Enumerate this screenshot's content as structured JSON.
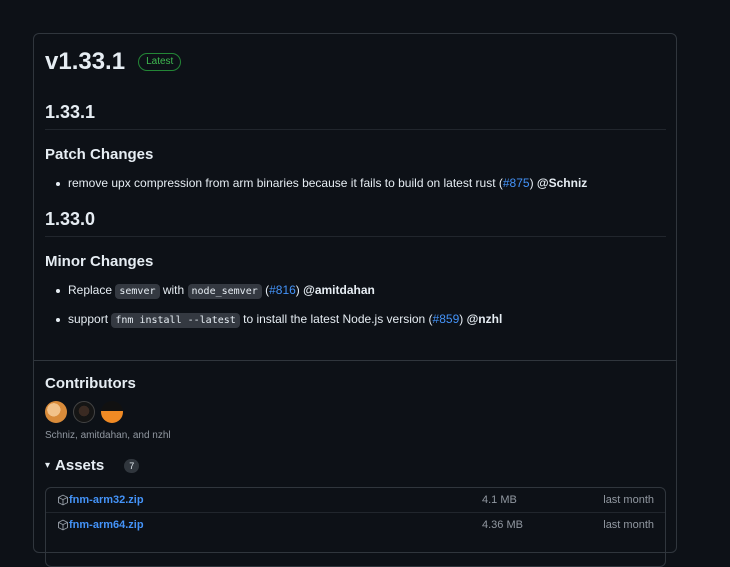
{
  "release": {
    "title": "v1.33.1",
    "badge": "Latest"
  },
  "sections": {
    "s1": {
      "heading": "1.33.1",
      "subheading": "Patch Changes",
      "items": [
        {
          "before": "remove upx compression from arm binaries because it fails to build on latest rust (",
          "link": "#875",
          "after": ") ",
          "user": "@Schniz"
        }
      ]
    },
    "s2": {
      "heading": "1.33.0",
      "subheading": "Minor Changes",
      "items": [
        {
          "before": "Replace ",
          "code1": "semver",
          "mid": " with ",
          "code2": "node_semver",
          "mid2": " (",
          "link": "#816",
          "after": ") ",
          "user": "@amitdahan"
        },
        {
          "before": "support ",
          "code1": "fnm install --latest",
          "mid": " to install the latest Node.js version (",
          "link": "#859",
          "after": ") ",
          "user": "@nzhl"
        }
      ]
    }
  },
  "contributors": {
    "title": "Contributors",
    "names": "Schniz, amitdahan, and nzhl"
  },
  "assets": {
    "title": "Assets",
    "count": "7",
    "rows": [
      {
        "name": "fnm-arm32.zip",
        "size": "4.1 MB",
        "date": "last month"
      },
      {
        "name": "fnm-arm64.zip",
        "size": "4.36 MB",
        "date": "last month"
      }
    ]
  },
  "colors": {
    "background": "#0d1117",
    "link": "#4493f8",
    "badge": "#3fb950"
  }
}
